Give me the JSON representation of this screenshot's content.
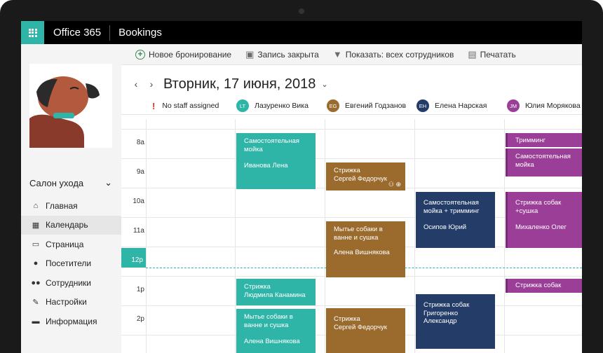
{
  "topbar": {
    "brand": "Office 365",
    "app": "Bookings"
  },
  "toolbar": {
    "new_booking": "Новое бронирование",
    "closed_entry": "Запись закрыта",
    "show_filter": "Показать: всех сотрудников",
    "print": "Печатать"
  },
  "sidebar": {
    "business_name": "Салон ухода",
    "items": [
      {
        "label": "Главная",
        "icon": "home-icon"
      },
      {
        "label": "Календарь",
        "icon": "calendar-icon"
      },
      {
        "label": "Страница",
        "icon": "laptop-icon"
      },
      {
        "label": "Посетители",
        "icon": "person-icon"
      },
      {
        "label": "Сотрудники",
        "icon": "people-icon"
      },
      {
        "label": "Настройки",
        "icon": "wrench-icon"
      },
      {
        "label": "Информация",
        "icon": "briefcase-icon"
      }
    ]
  },
  "calendar": {
    "date": "Вторник, 17 июня, 2018",
    "prev": "‹",
    "next": "›",
    "staff": [
      {
        "name": "No staff assigned",
        "initials": "",
        "color": "#c0392b"
      },
      {
        "name": "Лазуренко Вика",
        "initials": "LT",
        "color": "#2fb5a7"
      },
      {
        "name": "Евгений Годзанов",
        "initials": "EG",
        "color": "#9b6b2d"
      },
      {
        "name": "Елена Нарская",
        "initials": "EH",
        "color": "#233c68"
      },
      {
        "name": "Юлия Морякова",
        "initials": "JM",
        "color": "#9b3e98"
      }
    ],
    "times": [
      "8a",
      "9a",
      "10a",
      "11a",
      "12p",
      "1p",
      "2p"
    ],
    "now_time": "12p",
    "appointments": {
      "vika_1": {
        "title": "Самостоятельная мойка",
        "client": "Иванова Лена"
      },
      "vika_2": {
        "title": "Стрижка",
        "client": "Людмила Канамина"
      },
      "vika_3": {
        "title": "Мытье собаки в ванне и сушка",
        "client": "Алена Вишнякова"
      },
      "evg_1": {
        "title": "Стрижка",
        "client": "Сергей Федорчук"
      },
      "evg_2": {
        "title": "Мытье собаки в ванне и сушка",
        "client": "Алена Вишнякова"
      },
      "evg_3": {
        "title": "Стрижка",
        "client": "Сергей Федорчук"
      },
      "ele_1": {
        "title": "Самостоятельная мойка + тримминг",
        "client": "Осипов Юрий"
      },
      "ele_2": {
        "title": "Стрижка собак",
        "client": "Григоренко Александр"
      },
      "yul_1": {
        "title": "Тримминг",
        "client": ""
      },
      "yul_2": {
        "title": "Самостоятельная мойка",
        "client": ""
      },
      "yul_3": {
        "title": "Стрижка собак +сушка",
        "client": "Михаленко Олег"
      },
      "yul_4": {
        "title": "Стрижка собак",
        "client": ""
      }
    }
  }
}
